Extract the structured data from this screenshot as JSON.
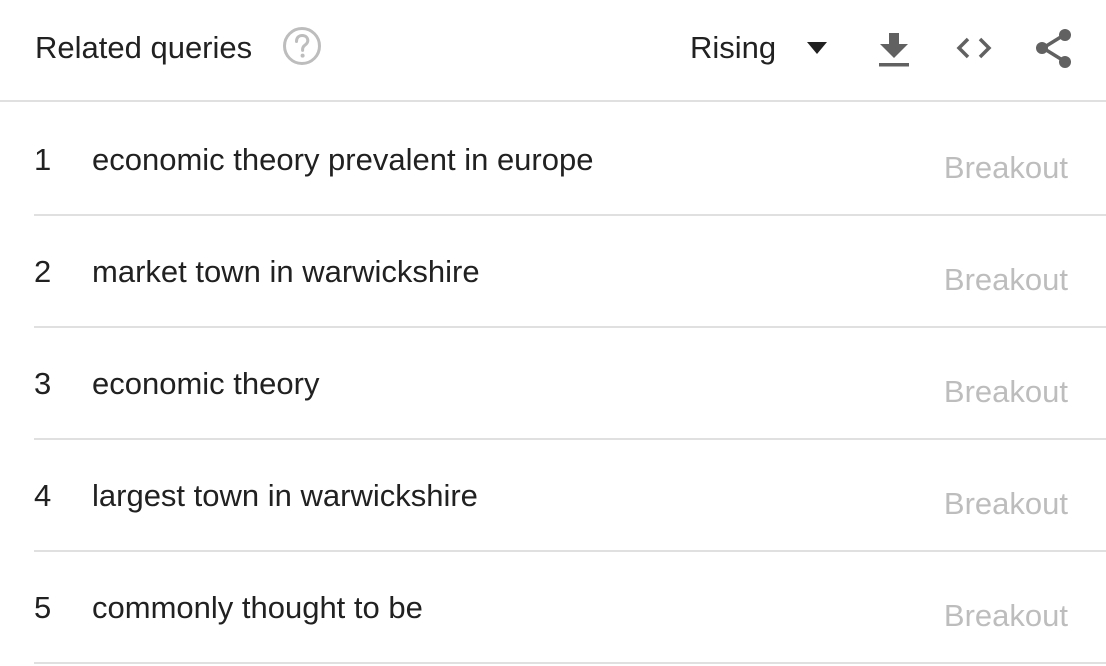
{
  "header": {
    "title": "Related queries",
    "help_icon": "help-circle-icon",
    "dropdown": {
      "selected": "Rising"
    },
    "tools": {
      "download_icon": "download-icon",
      "embed_icon": "code-embed-icon",
      "share_icon": "share-icon"
    }
  },
  "colors": {
    "text": "#212121",
    "muted": "#bdbdbd",
    "icon": "#616161",
    "divider": "#e0e0e0"
  },
  "rows": [
    {
      "rank": "1",
      "query": "economic theory prevalent in europe",
      "value": "Breakout"
    },
    {
      "rank": "2",
      "query": "market town in warwickshire",
      "value": "Breakout"
    },
    {
      "rank": "3",
      "query": "economic theory",
      "value": "Breakout"
    },
    {
      "rank": "4",
      "query": "largest town in warwickshire",
      "value": "Breakout"
    },
    {
      "rank": "5",
      "query": "commonly thought to be",
      "value": "Breakout"
    }
  ]
}
